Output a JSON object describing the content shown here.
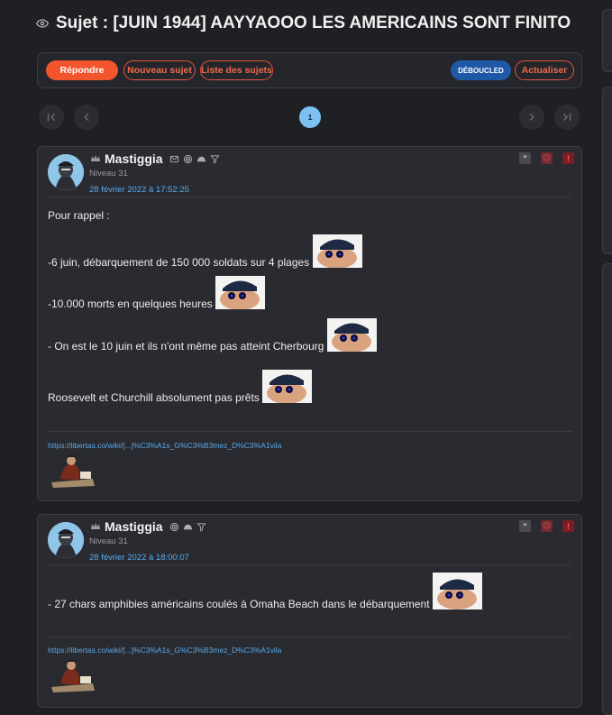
{
  "topic": {
    "title": "Sujet : [JUIN 1944] AAYYAOOO LES AMERICAINS SONT FINITO",
    "icon": "eye-icon"
  },
  "toolbar": {
    "reply_label": "Répondre",
    "new_topic_label": "Nouveau sujet",
    "topic_list_label": "Liste des sujets",
    "deboucled_label": "DÉBOUCLED",
    "refresh_label": "Actualiser"
  },
  "pagination": {
    "current_page": "1"
  },
  "colors": {
    "accent": "#f2552c",
    "link": "#59a8ea",
    "badge_blue": "#1f58a6",
    "page_active": "#7cc1f2"
  },
  "posts": [
    {
      "author": "Mastiggia",
      "level": "Niveau 31",
      "date": "28 février 2022 à 17:52:25",
      "lines": [
        "Pour rappel :",
        "-6 juin, débarquement de 150 000 soldats sur 4 plages",
        "-10.000 morts en quelques heures",
        "- On est le 10 juin et ils n'ont même pas atteint Cherbourg",
        "Roosevelt et Churchill absolument pas prêts"
      ],
      "signature_link": "https://libertas.co/wiki/[...]%C3%A1s_G%C3%B3mez_D%C3%A1vila"
    },
    {
      "author": "Mastiggia",
      "level": "Niveau 31",
      "date": "28 février 2022 à 18:00:07",
      "lines": [
        "- 27 chars amphibies américains coulés à Omaha Beach dans le débarquement"
      ],
      "signature_link": "https://libertas.co/wiki/[...]%C3%A1s_G%C3%B3mez_D%C3%A1vila"
    }
  ]
}
